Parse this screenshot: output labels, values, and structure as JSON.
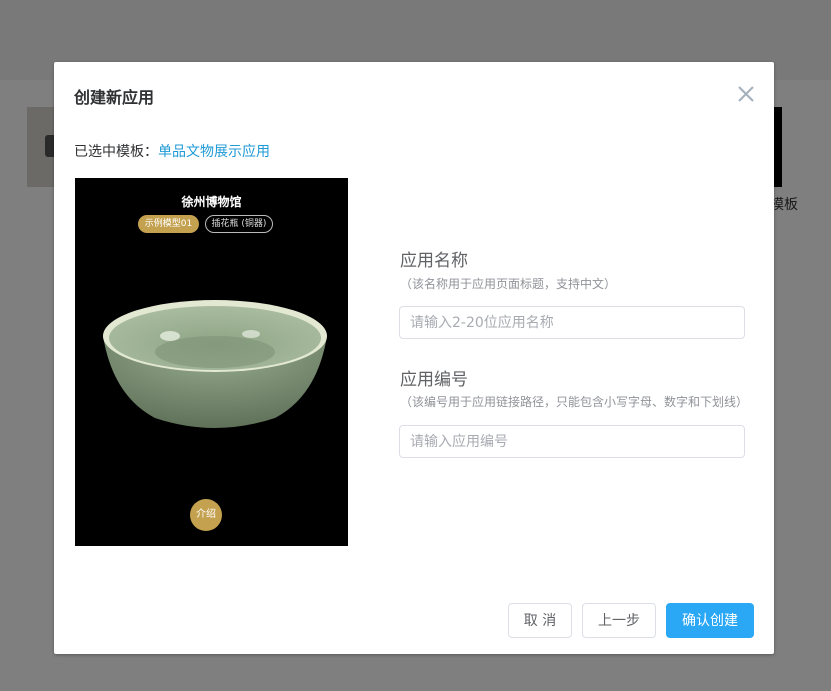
{
  "background": {
    "thumb_label": "模板"
  },
  "dialog": {
    "title": "创建新应用",
    "selected_prefix": "已选中模板：",
    "selected_template": "单品文物展示应用"
  },
  "preview": {
    "museum": "徐州博物馆",
    "tabs": [
      "示例模型01",
      "插花瓶 (铜器)"
    ],
    "intro": "介绍"
  },
  "form": {
    "name_label": "应用名称",
    "name_hint": "（该名称用于应用页面标题，支持中文）",
    "name_placeholder": "请输入2-20位应用名称",
    "code_label": "应用编号",
    "code_hint": "（该编号用于应用链接路径，只能包含小写字母、数字和下划线）",
    "code_placeholder": "请输入应用编号"
  },
  "footer": {
    "cancel": "取 消",
    "prev": "上一步",
    "confirm": "确认创建"
  },
  "colors": {
    "accent": "#2aa7f5",
    "link": "#1f9ad6",
    "gold": "#c3a14f"
  },
  "icons": {
    "close": "close-icon"
  }
}
